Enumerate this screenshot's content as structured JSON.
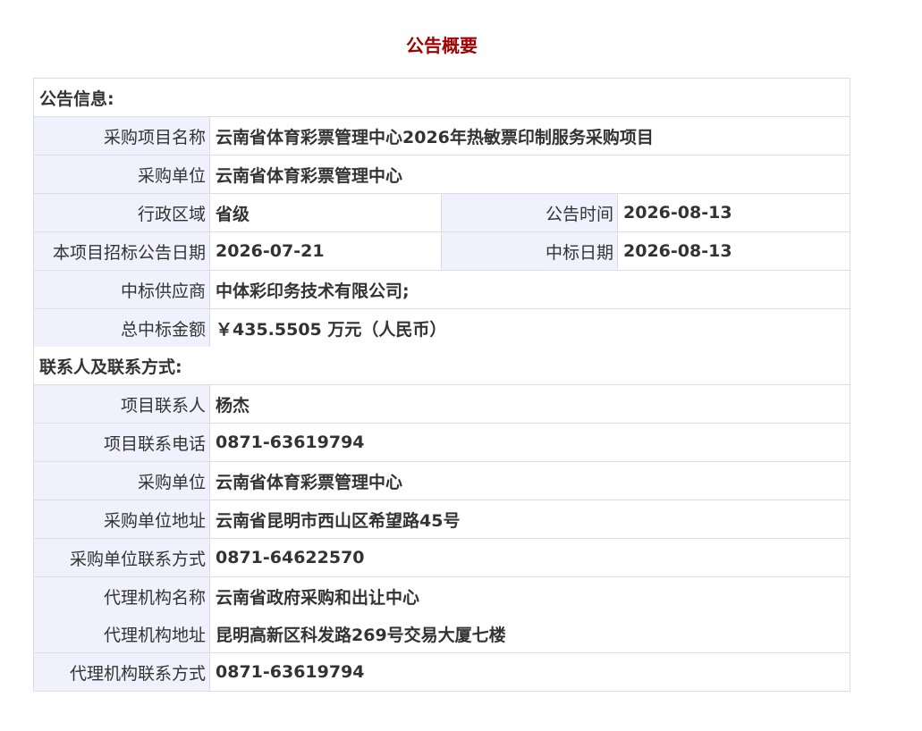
{
  "page_title": "公告概要",
  "section_announcement": "公告信息:",
  "announcement": {
    "project_name_label": "采购项目名称",
    "project_name": "云南省体育彩票管理中心2026年热敏票印制服务采购项目",
    "purchaser_label": "采购单位",
    "purchaser": "云南省体育彩票管理中心",
    "region_label": "行政区域",
    "region": "省级",
    "publish_time_label": "公告时间",
    "publish_time": "2026-08-13",
    "bid_announce_date_label": "本项目招标公告日期",
    "bid_announce_date": "2026-07-21",
    "award_date_label": "中标日期",
    "award_date": "2026-08-13",
    "winner_label": "中标供应商",
    "winner": "中体彩印务技术有限公司;",
    "total_amount_label": "总中标金额",
    "total_amount": "￥435.5505 万元（人民币）"
  },
  "section_contact": "联系人及联系方式:",
  "contact": {
    "project_contact_label": "项目联系人",
    "project_contact": "杨杰",
    "project_phone_label": "项目联系电话",
    "project_phone": "0871-63619794",
    "purchaser_label": "采购单位",
    "purchaser": "云南省体育彩票管理中心",
    "purchaser_address_label": "采购单位地址",
    "purchaser_address": "云南省昆明市西山区希望路45号",
    "purchaser_phone_label": "采购单位联系方式",
    "purchaser_phone": "0871-64622570",
    "agency_name_label": "代理机构名称",
    "agency_name": "云南省政府采购和出让中心",
    "agency_address_label": "代理机构地址",
    "agency_address": "昆明高新区科发路269号交易大厦七楼",
    "agency_phone_label": "代理机构联系方式",
    "agency_phone": "0871-63619794"
  }
}
